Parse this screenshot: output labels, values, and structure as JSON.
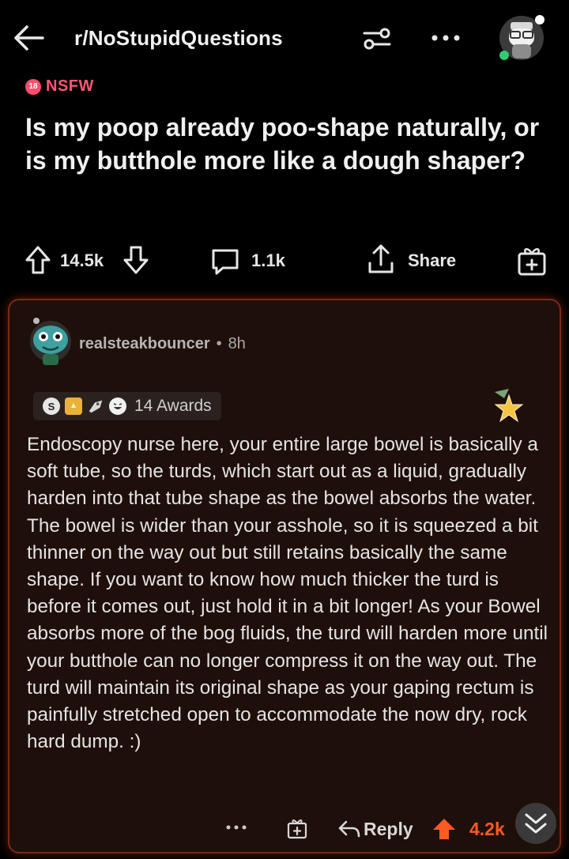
{
  "header": {
    "subreddit": "r/NoStupidQuestions"
  },
  "post": {
    "nsfw_label": "NSFW",
    "nsfw_badge": "18",
    "title": "Is my poop already poo-shape naturally, or is my butthole more like a dough shaper?",
    "upvotes": "14.5k",
    "comments": "1.1k",
    "share_label": "Share"
  },
  "comment": {
    "username": "realsteakbouncer",
    "separator": "•",
    "age": "8h",
    "awards_label": "14 Awards",
    "award_silver": "S",
    "body": "Endoscopy nurse here, your entire large bowel is basically a soft tube, so the turds, which start out as a liquid, gradually harden into that tube shape as the bowel absorbs the water. The bowel is wider than your asshole, so it is squeezed a bit thinner on the way out but still retains basically the same shape. If you want to know how much thicker the turd is before it comes out, just hold it in a bit longer! As your Bowel absorbs more of the bog fluids, the turd will harden more until your butthole can no longer compress it on the way out. The turd will maintain its original shape as your gaping rectum is painfully stretched open to accommodate the now dry, rock hard dump. :)",
    "reply_label": "Reply",
    "score": "4.2k"
  },
  "colors": {
    "background": "#000000",
    "nsfw": "#ff5774",
    "upvote_active": "#ff5a23",
    "card_border": "#7a2a12",
    "card_bg": "#1f0f0a"
  },
  "icons": [
    "back-arrow-icon",
    "filter-icon",
    "more-icon",
    "user-avatar",
    "upvote-icon",
    "downvote-icon",
    "comment-icon",
    "share-icon",
    "award-icon",
    "reply-icon",
    "collapse-icon"
  ]
}
